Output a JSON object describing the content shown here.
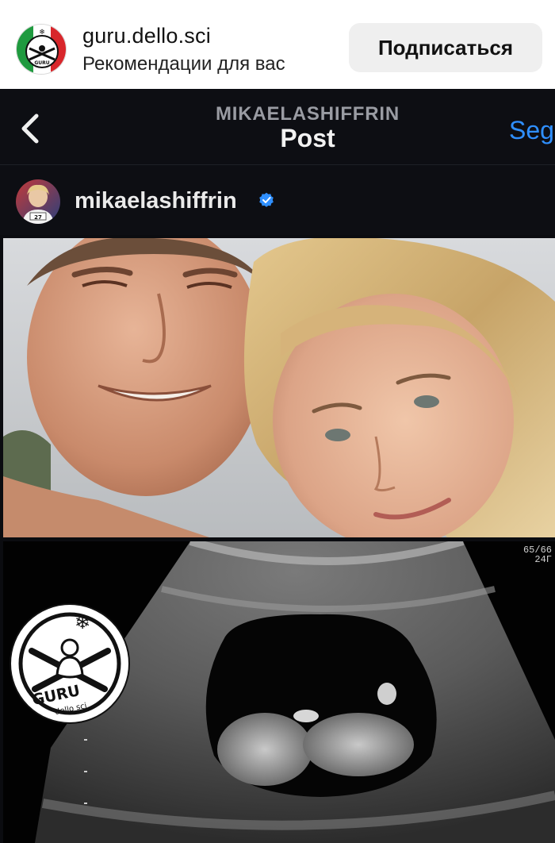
{
  "outer_header": {
    "account_name": "guru.dello.sci",
    "subtitle": "Рекомендации для вас",
    "follow_label": "Подписаться"
  },
  "embedded_post": {
    "nav_owner": "MIKAELASHIFFRIN",
    "nav_title": "Post",
    "nav_follow_label": "Seg",
    "author_name": "mikaelashiffrin",
    "verified": true,
    "verified_color": "#2f8fff"
  },
  "media": {
    "photo_1": "selfie-photo",
    "photo_2": "ultrasound-scan",
    "ultrasound_readout": [
      "65/66",
      "24Г"
    ]
  },
  "watermark": {
    "brand_text": "GURU",
    "brand_sub": "dello sci"
  },
  "colors": {
    "accent_blue": "#2f8fff",
    "dark_bg": "#0d0e13",
    "button_bg": "#efefef"
  }
}
